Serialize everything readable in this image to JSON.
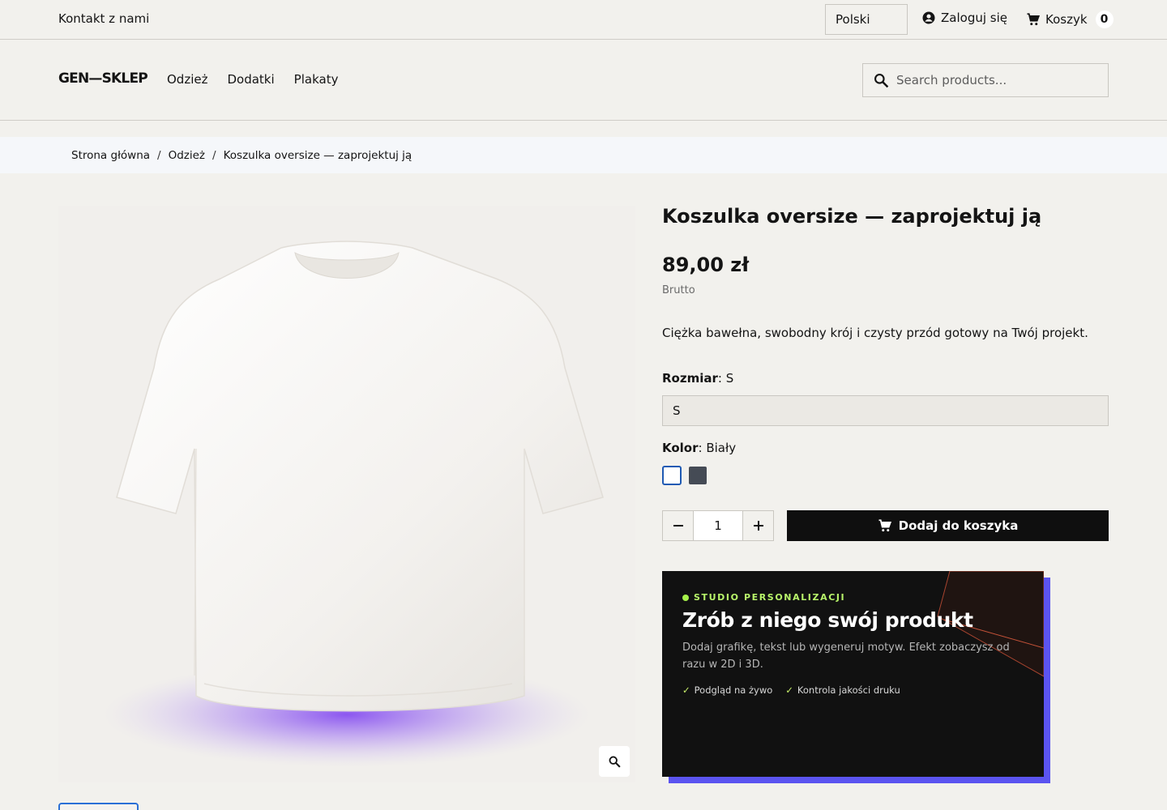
{
  "topbar": {
    "contact": "Kontakt z nami",
    "language": "Polski",
    "login": "Zaloguj się",
    "cart_label": "Koszyk",
    "cart_count": "0"
  },
  "header": {
    "logo": "GEN—SKLEP",
    "nav": [
      "Odzież",
      "Dodatki",
      "Plakaty"
    ],
    "search_placeholder": "Search products..."
  },
  "breadcrumb": [
    "Strona główna",
    "Odzież",
    "Koszulka oversize — zaprojektuj ją"
  ],
  "product": {
    "title": "Koszulka oversize — zaprojektuj ją",
    "price": "89,00 zł",
    "tax_note": "Brutto",
    "description": "Ciężka bawełna, swobodny krój i czysty przód gotowy na Twój projekt.",
    "size_label": "Rozmiar",
    "size_value": "S",
    "size_selected": "S",
    "color_label": "Kolor",
    "color_value": "Biały",
    "colors": [
      "#ffffff",
      "#454b55"
    ],
    "quantity": "1",
    "add_to_cart": "Dodaj do koszyka"
  },
  "studio": {
    "kicker": "STUDIO PERSONALIZACJI",
    "headline": "Zrób z niego swój produkt",
    "subtext": "Dodaj grafikę, tekst lub wygeneruj motyw. Efekt zobaczysz od razu w 2D i 3D.",
    "features": [
      "Podgląd na żywo",
      "Kontrola jakości druku"
    ],
    "accent_color": "#5b54f0"
  }
}
